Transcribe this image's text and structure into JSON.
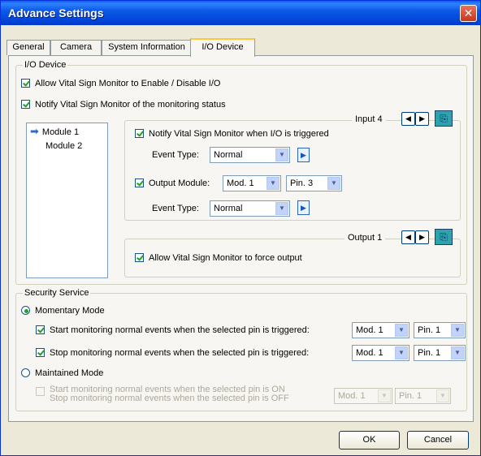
{
  "window": {
    "title": "Advance Settings",
    "close_glyph": "✕"
  },
  "tabs": [
    "General",
    "Camera",
    "System Information",
    "I/O Device"
  ],
  "io_device": {
    "legend": "I/O Device",
    "allow_enable_disable": "Allow Vital Sign Monitor to Enable / Disable I/O",
    "notify_monitoring_status": "Notify Vital Sign Monitor of the monitoring status",
    "modules": [
      "Module 1",
      "Module 2"
    ],
    "input": {
      "label": "Input 4",
      "notify_triggered": "Notify Vital Sign Monitor when I/O is triggered",
      "event_type_label": "Event Type:",
      "event_type_value": "Normal",
      "output_module_label": "Output Module:",
      "output_module_value": "Mod. 1",
      "output_pin_value": "Pin. 3",
      "event_type2_value": "Normal"
    },
    "output": {
      "label": "Output 1",
      "force_output": "Allow Vital Sign Monitor to force output"
    }
  },
  "security": {
    "legend": "Security Service",
    "momentary": "Momentary Mode",
    "start_label": "Start monitoring normal events when the selected pin is triggered:",
    "stop_label": "Stop monitoring normal events when the selected pin is triggered:",
    "start_mod": "Mod. 1",
    "start_pin": "Pin. 1",
    "stop_mod": "Mod. 1",
    "stop_pin": "Pin. 1",
    "maintained": "Maintained Mode",
    "maintained_line1": "Start monitoring normal events when the selected pin is ON",
    "maintained_line2": "Stop monitoring normal events when the selected pin is OFF",
    "maintained_mod": "Mod. 1",
    "maintained_pin": "Pin. 1"
  },
  "buttons": {
    "ok": "OK",
    "cancel": "Cancel"
  },
  "icons": {
    "dropdown": "▼",
    "left": "◀",
    "right": "▶",
    "go": "▶",
    "module_arrow": "➡"
  },
  "colors": {
    "title_bar": "#0a5fea",
    "selection": "#316ac5",
    "checkmark": "#21a121"
  }
}
